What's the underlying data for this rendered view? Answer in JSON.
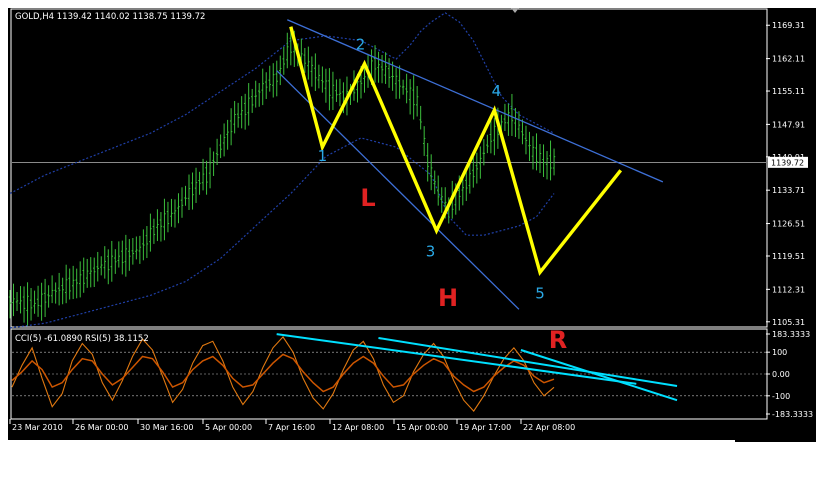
{
  "chart_data": [
    {
      "type": "candlestick",
      "symbol_header": "GOLD,H4  1139.42 1140.02 1138.75 1139.72",
      "price_ticks": [
        "1169.31",
        "1162.11",
        "1155.11",
        "1147.91",
        "1140.91",
        "1133.71",
        "1126.51",
        "1119.51",
        "1112.31",
        "1105.31"
      ],
      "current_price": "1139.72",
      "date_ticks": [
        "23 Mar 2010",
        "26 Mar 00:00",
        "30 Mar 16:00",
        "5 Apr 00:00",
        "7 Apr 16:00",
        "12 Apr 08:00",
        "15 Apr 00:00",
        "19 Apr 17:00",
        "22 Apr 08:00"
      ],
      "ylim": [
        1104.4,
        1172.6
      ],
      "price_path": [
        [
          0,
          1110
        ],
        [
          14,
          1109
        ],
        [
          26,
          1112
        ],
        [
          38,
          1114
        ],
        [
          50,
          1117
        ],
        [
          62,
          1119
        ],
        [
          74,
          1121
        ],
        [
          84,
          1126
        ],
        [
          94,
          1129
        ],
        [
          104,
          1134
        ],
        [
          112,
          1137
        ],
        [
          120,
          1143
        ],
        [
          128,
          1149
        ],
        [
          136,
          1152
        ],
        [
          144,
          1156
        ],
        [
          152,
          1158
        ],
        [
          160,
          1165
        ],
        [
          168,
          1162
        ],
        [
          176,
          1158
        ],
        [
          184,
          1155
        ],
        [
          192,
          1154
        ],
        [
          200,
          1157
        ],
        [
          208,
          1161
        ],
        [
          216,
          1159
        ],
        [
          224,
          1156
        ],
        [
          232,
          1153
        ],
        [
          238,
          1140
        ],
        [
          244,
          1133
        ],
        [
          250,
          1130
        ],
        [
          256,
          1133
        ],
        [
          262,
          1136
        ],
        [
          268,
          1140
        ],
        [
          274,
          1145
        ],
        [
          280,
          1148
        ],
        [
          286,
          1150
        ],
        [
          292,
          1146
        ],
        [
          298,
          1142
        ],
        [
          304,
          1140
        ],
        [
          310,
          1139.72
        ]
      ],
      "upper_envelope": [
        [
          0,
          1133
        ],
        [
          20,
          1137
        ],
        [
          40,
          1140
        ],
        [
          60,
          1143
        ],
        [
          80,
          1146
        ],
        [
          100,
          1150
        ],
        [
          120,
          1155
        ],
        [
          140,
          1160
        ],
        [
          160,
          1166
        ],
        [
          180,
          1167
        ],
        [
          200,
          1166
        ],
        [
          210,
          1164
        ],
        [
          220,
          1162
        ],
        [
          228,
          1165
        ],
        [
          234,
          1168
        ],
        [
          240,
          1170
        ],
        [
          248,
          1172
        ],
        [
          256,
          1170
        ],
        [
          264,
          1166
        ],
        [
          272,
          1160
        ],
        [
          280,
          1154
        ],
        [
          290,
          1150
        ],
        [
          300,
          1148
        ],
        [
          310,
          1146
        ]
      ],
      "lower_envelope": [
        [
          0,
          1104
        ],
        [
          20,
          1105
        ],
        [
          40,
          1107
        ],
        [
          60,
          1109
        ],
        [
          80,
          1111
        ],
        [
          100,
          1114
        ],
        [
          120,
          1119
        ],
        [
          140,
          1126
        ],
        [
          160,
          1133
        ],
        [
          180,
          1141
        ],
        [
          200,
          1145
        ],
        [
          220,
          1143
        ],
        [
          240,
          1137
        ],
        [
          250,
          1128
        ],
        [
          260,
          1124
        ],
        [
          270,
          1124
        ],
        [
          280,
          1125
        ],
        [
          290,
          1126
        ],
        [
          300,
          1128
        ],
        [
          310,
          1133
        ]
      ],
      "pattern_points": [
        {
          "label": "",
          "x": 160,
          "y": 1169
        },
        {
          "label": "1",
          "x": 178,
          "y": 1143
        },
        {
          "label": "2",
          "x": 202,
          "y": 1161
        },
        {
          "label": "3",
          "x": 243,
          "y": 1125
        },
        {
          "label": "4",
          "x": 276,
          "y": 1151
        },
        {
          "label": "5",
          "x": 302,
          "y": 1116
        },
        {
          "label": "",
          "x": 348,
          "y": 1138
        }
      ],
      "channel_upper": [
        [
          158,
          1170.5
        ],
        [
          372,
          1135.5
        ]
      ],
      "channel_lower": [
        [
          152,
          1159.5
        ],
        [
          290,
          1108
        ]
      ],
      "annotations": [
        "L",
        "H",
        "R"
      ],
      "colors": {
        "background": "#000000",
        "candles": "#3cbf3c",
        "envelope": "#1f3fa6",
        "pattern": "#ffff00",
        "channel": "#3d6fd6",
        "pattern_numbers": "#2aa9e6",
        "annotation_letters": "#e02222",
        "axis": "#ffffff"
      }
    },
    {
      "type": "line",
      "title": "CCI(5) -61.0890  RSI(5) 38.1152",
      "level_ticks": [
        "183.3333",
        "100",
        "0.00",
        "-100",
        "-183.3333"
      ],
      "ylim": [
        -183.3333,
        183.3333
      ],
      "series": [
        {
          "name": "CCI(5)",
          "values": [
            -60,
            40,
            120,
            -20,
            -150,
            -90,
            60,
            140,
            90,
            -40,
            -120,
            -30,
            80,
            160,
            110,
            -10,
            -130,
            -70,
            50,
            130,
            150,
            60,
            -60,
            -140,
            -80,
            30,
            120,
            170,
            100,
            -20,
            -110,
            -160,
            -90,
            20,
            110,
            150,
            70,
            -50,
            -130,
            -100,
            10,
            90,
            140,
            80,
            -30,
            -120,
            -170,
            -100,
            -10,
            70,
            120,
            60,
            -40,
            -100,
            -61
          ]
        },
        {
          "name": "RSI(5)",
          "values": [
            -30,
            10,
            60,
            20,
            -60,
            -40,
            20,
            70,
            60,
            0,
            -50,
            -20,
            30,
            80,
            70,
            10,
            -60,
            -40,
            20,
            60,
            80,
            40,
            -20,
            -60,
            -50,
            0,
            50,
            90,
            70,
            10,
            -40,
            -80,
            -60,
            0,
            50,
            80,
            50,
            -10,
            -60,
            -50,
            0,
            40,
            70,
            50,
            -10,
            -50,
            -80,
            -60,
            -10,
            30,
            60,
            40,
            -10,
            -40,
            -24
          ]
        }
      ],
      "channel_upper": [
        [
          0.54,
          165
        ],
        [
          0.98,
          -55
        ]
      ],
      "channel_lower": [
        [
          0.75,
          110
        ],
        [
          0.98,
          -120
        ]
      ],
      "channel_third": [
        [
          0.39,
          183
        ],
        [
          0.92,
          -45
        ]
      ],
      "colors": {
        "cci": "#e07810",
        "rsi": "#cc5500",
        "channel": "#00e0ff",
        "levels": "#ffffff"
      }
    }
  ]
}
